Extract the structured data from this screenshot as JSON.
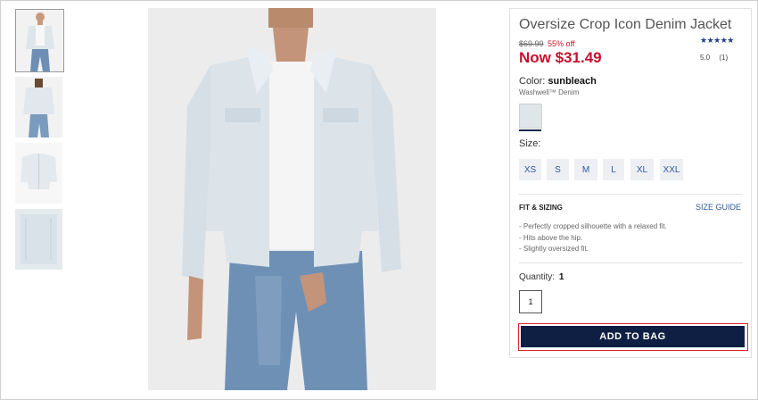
{
  "product": {
    "title": "Oversize Crop Icon Denim Jacket",
    "old_price": "$69.99",
    "discount": "55% off",
    "now_price": "Now $31.49",
    "stars": "★★★★★",
    "rating": "5.0",
    "review_count": "(1)"
  },
  "color": {
    "label": "Color:",
    "value": "sunbleach",
    "fabric": "Washwell™ Denim"
  },
  "size": {
    "label": "Size:",
    "options": [
      "XS",
      "S",
      "M",
      "L",
      "XL",
      "XXL"
    ]
  },
  "fit": {
    "title": "FIT & SIZING",
    "guide_link": "SIZE GUIDE",
    "bullets": [
      "- Perfectly cropped silhouette with a relaxed fit.",
      "- Hits above the hip.",
      "- Slightly oversized fit."
    ]
  },
  "quantity": {
    "label": "Quantity:",
    "value": "1",
    "input_value": "1"
  },
  "cta": {
    "add_to_bag": "ADD TO BAG"
  },
  "colors": {
    "sale_red": "#c8102e",
    "navy": "#0f1f44",
    "link_blue": "#2a5aa0"
  }
}
